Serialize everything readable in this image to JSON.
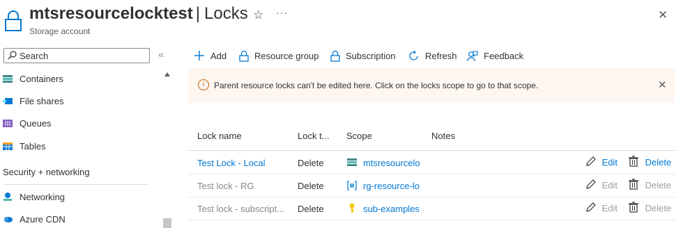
{
  "header": {
    "resource_name": "mtsresourcelocktest",
    "separator": "|",
    "page_name": "Locks",
    "subtitle": "Storage account",
    "star_icon": "☆",
    "more_icon": "···",
    "close_icon": "✕"
  },
  "sidebar": {
    "search_placeholder": "Search",
    "collapse_icon": "«",
    "items": [
      {
        "label": "Containers",
        "icon": "containers-icon"
      },
      {
        "label": "File shares",
        "icon": "file-shares-icon"
      },
      {
        "label": "Queues",
        "icon": "queues-icon"
      },
      {
        "label": "Tables",
        "icon": "tables-icon"
      },
      {
        "label": "Networking",
        "icon": "networking-icon"
      },
      {
        "label": "Azure CDN",
        "icon": "azure-cdn-icon"
      }
    ],
    "section_label": "Security + networking"
  },
  "toolbar": {
    "add": "Add",
    "resource_group": "Resource group",
    "subscription": "Subscription",
    "refresh": "Refresh",
    "feedback": "Feedback"
  },
  "banner": {
    "message": "Parent resource locks can't be edited here. Click on the locks scope to go to that scope.",
    "info_icon": "i",
    "close_icon": "✕"
  },
  "table": {
    "headers": {
      "name": "Lock name",
      "type": "Lock t...",
      "scope": "Scope",
      "notes": "Notes"
    },
    "rows": [
      {
        "name": "Test Lock - Local",
        "type": "Delete",
        "scope": "mtsresourcelo",
        "scope_icon": "storage-icon",
        "notes": "",
        "edit": "Edit",
        "delete": "Delete",
        "enabled": true
      },
      {
        "name": "Test lock - RG",
        "type": "Delete",
        "scope": "rg-resource-lo",
        "scope_icon": "resource-group-icon",
        "notes": "",
        "edit": "Edit",
        "delete": "Delete",
        "enabled": false
      },
      {
        "name": "Test lock - subscript...",
        "type": "Delete",
        "scope": "sub-examples",
        "scope_icon": "key-icon",
        "notes": "",
        "edit": "Edit",
        "delete": "Delete",
        "enabled": false
      }
    ]
  },
  "colors": {
    "link": "#0078d4",
    "disabled": "#8a8886",
    "banner_bg": "#fdf6f1",
    "warning": "#c45d00"
  }
}
